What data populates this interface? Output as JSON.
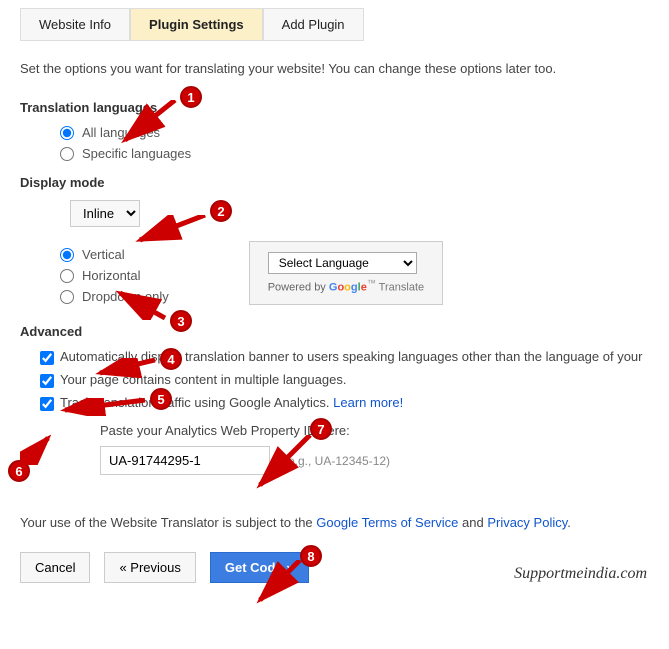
{
  "tabs": {
    "website_info": "Website Info",
    "plugin_settings": "Plugin Settings",
    "add_plugin": "Add Plugin"
  },
  "intro": "Set the options you want for translating your website! You can change these options later too.",
  "sections": {
    "translation_languages": "Translation languages",
    "display_mode": "Display mode",
    "advanced": "Advanced"
  },
  "radios": {
    "all_languages": "All languages",
    "specific_languages": "Specific languages",
    "vertical": "Vertical",
    "horizontal": "Horizontal",
    "dropdown_only": "Dropdown only"
  },
  "display_select": "Inline",
  "preview": {
    "select_language": "Select Language",
    "powered_prefix": "Powered by ",
    "translate": " Translate"
  },
  "checks": {
    "auto_banner": "Automatically display translation banner to users speaking languages other than the language of your",
    "multi_lang": "Your page contains content in multiple languages.",
    "track_analytics": "Track translation traffic using Google Analytics. ",
    "learn_more": "Learn more!"
  },
  "analytics": {
    "label": "Paste your Analytics Web Property ID here:",
    "value": "UA-91744295-1",
    "hint": "(e.g., UA-12345-12)"
  },
  "terms": {
    "prefix": "Your use of the Website Translator is subject to the ",
    "tos": "Google Terms of Service",
    "and": " and ",
    "privacy": "Privacy Policy",
    "dot": "."
  },
  "buttons": {
    "cancel": "Cancel",
    "previous": "« Previous",
    "get_code": "Get Code »"
  },
  "watermark": "Supportmeindia.com",
  "badges": [
    "1",
    "2",
    "3",
    "4",
    "5",
    "6",
    "7",
    "8"
  ]
}
